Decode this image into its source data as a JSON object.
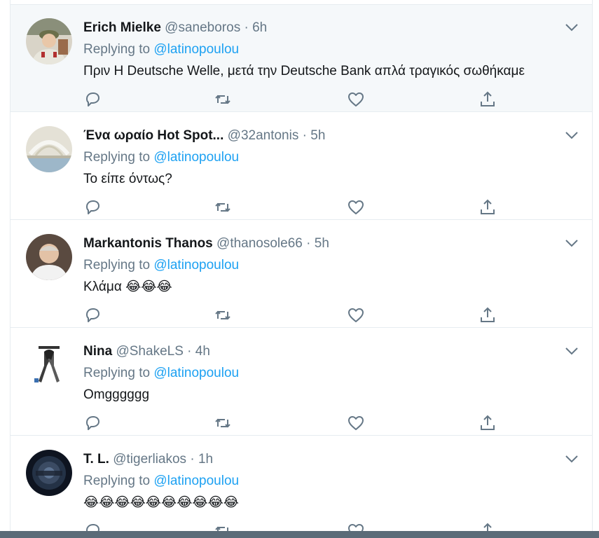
{
  "tweets": [
    {
      "name": "Erich Mielke",
      "handle": "@saneboros",
      "separator": "·",
      "time": "6h",
      "replying_prefix": "Replying to",
      "replying_to": "@latinopoulou",
      "text": "Πριν  Η Deutsche Welle, μετά την Deutsche Bank απλά τραγικός σωθήκαμε"
    },
    {
      "name": "Ένα ωραίο Hot Spot...",
      "handle": "@32antonis",
      "separator": "·",
      "time": "5h",
      "replying_prefix": "Replying to",
      "replying_to": "@latinopoulou",
      "text": "Το είπε όντως?"
    },
    {
      "name": "Markantonis Thanos",
      "handle": "@thanosole66",
      "separator": "·",
      "time": "5h",
      "replying_prefix": "Replying to",
      "replying_to": "@latinopoulou",
      "text": "Κλάμα 😂😂😂"
    },
    {
      "name": "Nina",
      "handle": "@ShakeLS",
      "separator": "·",
      "time": "4h",
      "replying_prefix": "Replying to",
      "replying_to": "@latinopoulou",
      "text": "Omgggggg"
    },
    {
      "name": "T. L.",
      "handle": "@tigerliakos",
      "separator": "·",
      "time": "1h",
      "replying_prefix": "Replying to",
      "replying_to": "@latinopoulou",
      "text": "😂😂😂😂😂😂😂😂😂😂"
    }
  ],
  "icons": {
    "reply": "reply-icon",
    "retweet": "retweet-icon",
    "like": "heart-icon",
    "share": "share-icon",
    "menu": "chevron-down-icon"
  },
  "colors": {
    "accent": "#1da1f2",
    "secondary_text": "#657786",
    "icon": "#657786",
    "highlight_bg": "#f5f8fa"
  }
}
